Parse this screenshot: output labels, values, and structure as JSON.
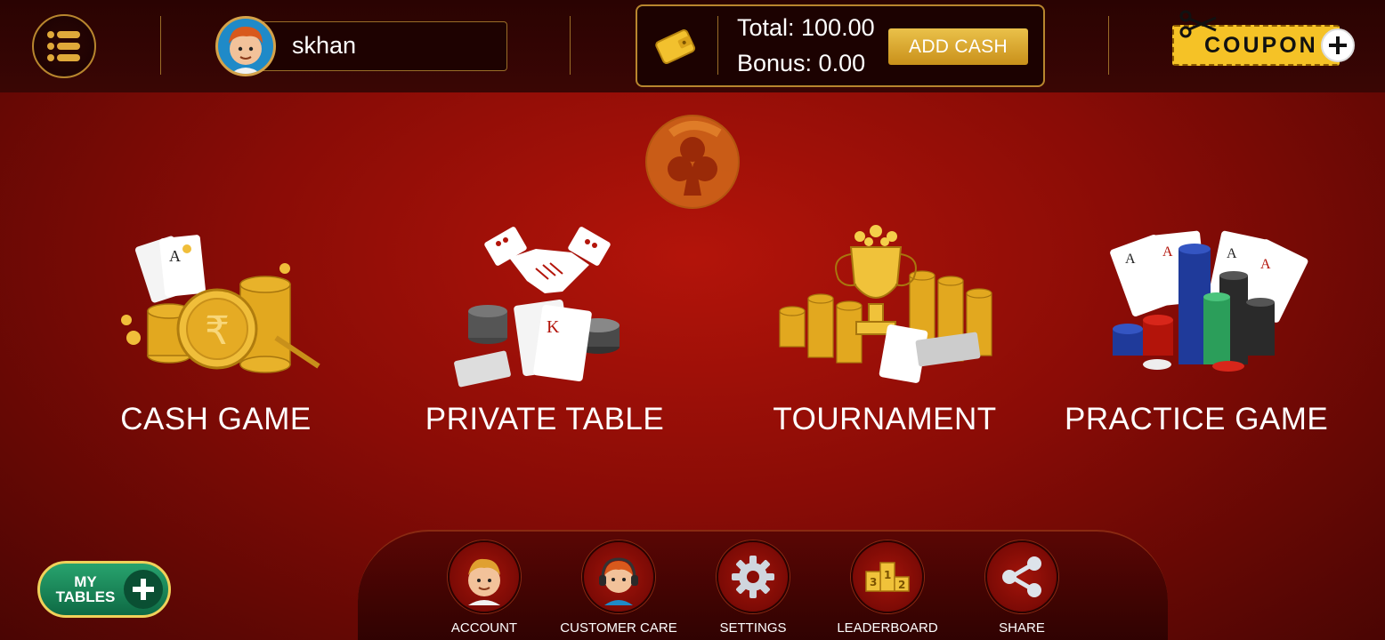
{
  "header": {
    "username": "skhan",
    "wallet": {
      "total_label": "Total: 100.00",
      "bonus_label": "Bonus: 0.00",
      "add_cash_label": "ADD CASH"
    },
    "coupon_label": "COUPON"
  },
  "games": [
    {
      "label": "CASH GAME"
    },
    {
      "label": "PRIVATE TABLE"
    },
    {
      "label": "TOURNAMENT"
    },
    {
      "label": "PRACTICE GAME"
    }
  ],
  "bottom_nav": [
    {
      "label": "ACCOUNT",
      "icon": "account-avatar-icon"
    },
    {
      "label": "CUSTOMER CARE",
      "icon": "customer-care-icon"
    },
    {
      "label": "SETTINGS",
      "icon": "gear-icon"
    },
    {
      "label": "LEADERBOARD",
      "icon": "podium-icon"
    },
    {
      "label": "SHARE",
      "icon": "share-icon"
    }
  ],
  "my_tables_label": "MY TABLES",
  "colors": {
    "accent_gold": "#d4a24a",
    "background_red": "#b3140a",
    "coupon_yellow": "#f5c226",
    "my_tables_green": "#28a36e"
  }
}
